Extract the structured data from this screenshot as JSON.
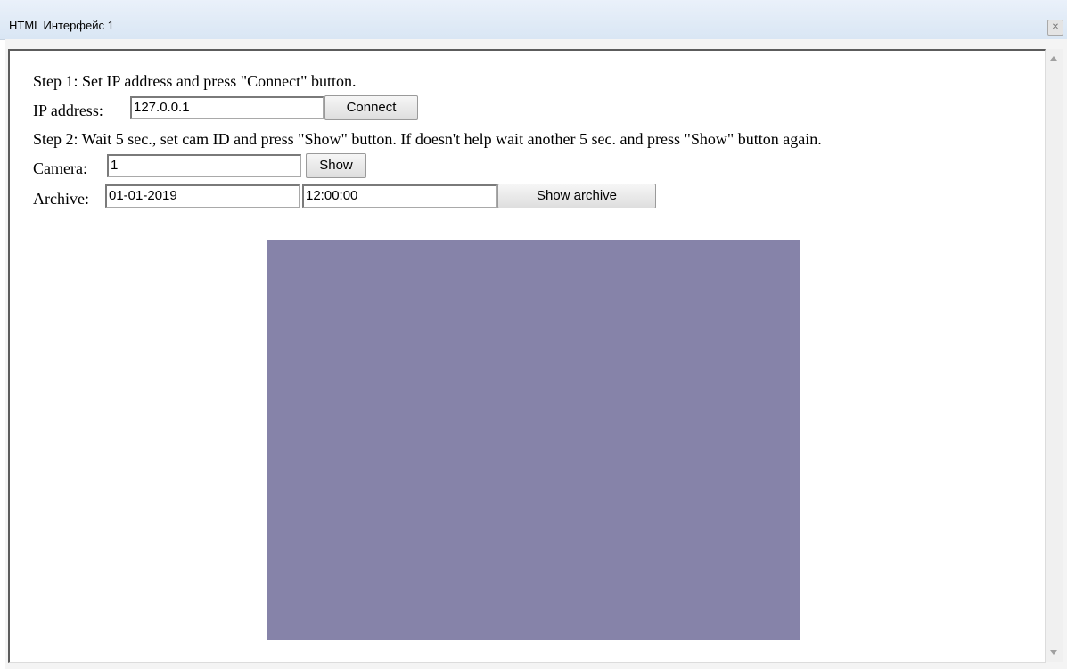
{
  "window": {
    "title": "HTML Интерфейс 1",
    "close_glyph": "✕"
  },
  "step1": {
    "text": "Step 1: Set IP address and press \"Connect\" button."
  },
  "ip": {
    "label": "IP address:",
    "value": "127.0.0.1",
    "button": "Connect"
  },
  "step2": {
    "text": "Step 2: Wait 5 sec., set cam ID and press \"Show\" button. If doesn't help wait another 5 sec. and press \"Show\" button again."
  },
  "camera": {
    "label": "Camera:",
    "value": "1",
    "button": "Show"
  },
  "archive": {
    "label": "Archive:",
    "date": "01-01-2019",
    "time": "12:00:00",
    "button": "Show archive"
  },
  "colors": {
    "video_bg": "#8683a9"
  }
}
